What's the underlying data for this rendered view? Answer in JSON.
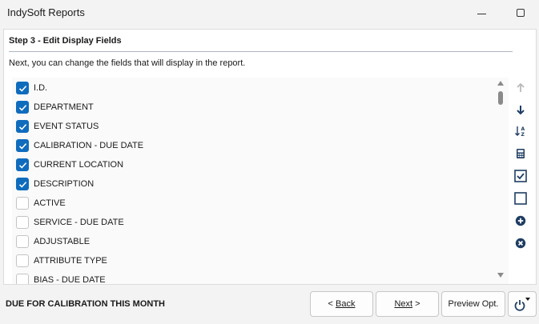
{
  "window": {
    "title": "IndySoft Reports"
  },
  "step": {
    "title": "Step 3 - Edit Display Fields",
    "instruction": "Next, you can change the fields that will display in the report."
  },
  "fields": [
    {
      "label": "I.D.",
      "checked": true
    },
    {
      "label": "DEPARTMENT",
      "checked": true
    },
    {
      "label": "EVENT STATUS",
      "checked": true
    },
    {
      "label": "CALIBRATION - DUE DATE",
      "checked": true
    },
    {
      "label": "CURRENT LOCATION",
      "checked": true
    },
    {
      "label": "DESCRIPTION",
      "checked": true
    },
    {
      "label": "ACTIVE",
      "checked": false
    },
    {
      "label": "SERVICE - DUE DATE",
      "checked": false
    },
    {
      "label": "ADJUSTABLE",
      "checked": false
    },
    {
      "label": "ATTRIBUTE TYPE",
      "checked": false
    },
    {
      "label": "BIAS - DUE DATE",
      "checked": false
    }
  ],
  "toolbar": {
    "icons": [
      "arrow-up-icon",
      "arrow-down-icon",
      "sort-az-icon",
      "calculator-icon",
      "check-all-icon",
      "uncheck-all-icon",
      "add-icon",
      "remove-icon"
    ],
    "disabled": [
      "arrow-up-icon"
    ]
  },
  "footer": {
    "report_name": "DUE FOR CALIBRATION THIS MONTH",
    "back_prefix": "< ",
    "back_label": "Back",
    "next_label": "Next",
    "next_suffix": " >",
    "preview_label": "Preview Opt."
  },
  "colors": {
    "accent": "#0f6cbd",
    "toolbar_icon": "#1f3d63",
    "disabled_icon": "#b9b9b9"
  }
}
